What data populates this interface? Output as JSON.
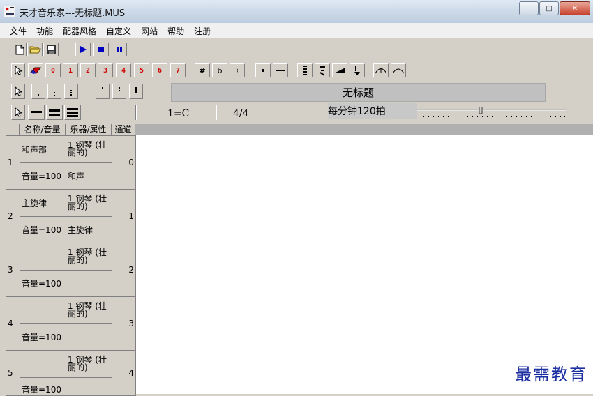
{
  "window": {
    "title": "天才音乐家---无标题.MUS",
    "minimize_label": "─",
    "maximize_label": "□",
    "close_label": "✕"
  },
  "menu": [
    "文件",
    "功能",
    "配器风格",
    "自定义",
    "网站",
    "帮助",
    "注册"
  ],
  "toolbar2": {
    "numbers": [
      "0",
      "1",
      "2",
      "3",
      "4",
      "5",
      "6",
      "7"
    ],
    "accidentals": [
      "#",
      "b",
      "♮"
    ]
  },
  "song_title": "无标题",
  "key": "1=C",
  "time_signature": "4/4",
  "tempo": "每分钟120拍",
  "grid_headers": {
    "name_volume": "名称/音量",
    "instrument_attr": "乐器/属性",
    "channel": "通道"
  },
  "tracks": [
    {
      "num": "1",
      "name": "和声部",
      "instrument": "1 钢琴 (壮丽的)",
      "channel": "0",
      "volume": "音量=100",
      "attr": "和声"
    },
    {
      "num": "2",
      "name": "主旋律",
      "instrument": "1 钢琴 (壮丽的)",
      "channel": "1",
      "volume": "音量=100",
      "attr": "主旋律"
    },
    {
      "num": "3",
      "name": "",
      "instrument": "1 钢琴 (壮丽的)",
      "channel": "2",
      "volume": "音量=100",
      "attr": ""
    },
    {
      "num": "4",
      "name": "",
      "instrument": "1 钢琴 (壮丽的)",
      "channel": "3",
      "volume": "音量=100",
      "attr": ""
    },
    {
      "num": "5",
      "name": "",
      "instrument": "1 钢琴 (壮丽的)",
      "channel": "4",
      "volume": "音量=100",
      "attr": ""
    }
  ],
  "watermark": "最需教育",
  "colors": {
    "accent_red": "#d10000",
    "play_blue": "#0000c0",
    "watermark": "#1c2fa0"
  }
}
